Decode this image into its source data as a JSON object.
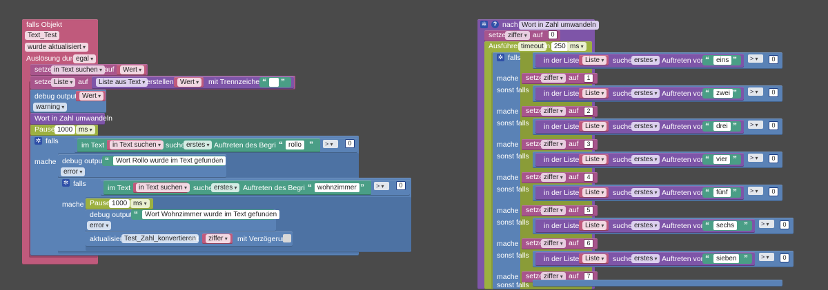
{
  "colors": {
    "canvas": "#4a4a4a",
    "event": "#c05a7c",
    "var": "#a8558c",
    "list": "#7e55a8",
    "logic": "#5a82b6",
    "text": "#4a9e86",
    "timer": "#9cb040",
    "system": "#5a82b6"
  },
  "left": {
    "falls_objekt": "falls Objekt",
    "object_id": "Text_Test",
    "condition": "wurde aktualisiert",
    "trigger_label": "Auslösung durch",
    "trigger_value": "egal",
    "setze": "setze",
    "var_in_text": "in Text suchen",
    "auf": "auf",
    "wert": "Wert",
    "var_liste": "Liste",
    "liste_aus_text": "Liste aus Text",
    "erstellen": "erstellen",
    "mit_trennzeichen": "mit Trennzeichen",
    "debug_output": "debug output",
    "level_warning": "warning",
    "call_func": "Wort in Zahl umwandeln",
    "pause": "Pause",
    "pause_value": "1000",
    "ms": "ms",
    "falls": "falls",
    "im_text": "im Text",
    "suche": "suche",
    "erstes": "erstes",
    "auftreten_begriffs": "Auftreten des Begriffs",
    "term1": "rollo",
    "cmp_op": ">",
    "zero": "0",
    "mache": "mache",
    "msg1": "Wort Rollo wurde im Text gefunden",
    "level_error": "error",
    "term2": "wohnzimmer",
    "msg2": "Wort Wohnzimmer wurde im Text gefunden",
    "aktualisiere": "aktualisiere",
    "target_state": "Test_Zahl_konvertieren",
    "mit": "mit",
    "var_ziffer": "ziffer",
    "mit_verzoegerung": "mit Verzögerung"
  },
  "right": {
    "nach": "nach",
    "func_name": "Wort in Zahl umwandeln",
    "setze": "setze",
    "var_ziffer": "ziffer",
    "auf": "auf",
    "init_value": "0",
    "ausfuehren": "Ausführen",
    "timeout": "timeout",
    "in": "in",
    "timeout_value": "250",
    "ms": "ms",
    "falls": "falls",
    "sonst_falls": "sonst falls",
    "mache": "mache",
    "in_der_liste": "in der Liste",
    "liste": "Liste",
    "suche": "suche",
    "erstes": "erstes",
    "auftreten_von": "Auftreten von",
    "cmp_op": ">",
    "zero": "0",
    "words": [
      "eins",
      "zwei",
      "drei",
      "vier",
      "fünf",
      "sechs",
      "sieben"
    ],
    "numbers": [
      "1",
      "2",
      "3",
      "4",
      "5",
      "6",
      "7"
    ]
  },
  "icons": {
    "gear": "gear-icon",
    "help": "help-icon",
    "quote": "quote-icon",
    "checkbox": "checkbox-icon"
  }
}
